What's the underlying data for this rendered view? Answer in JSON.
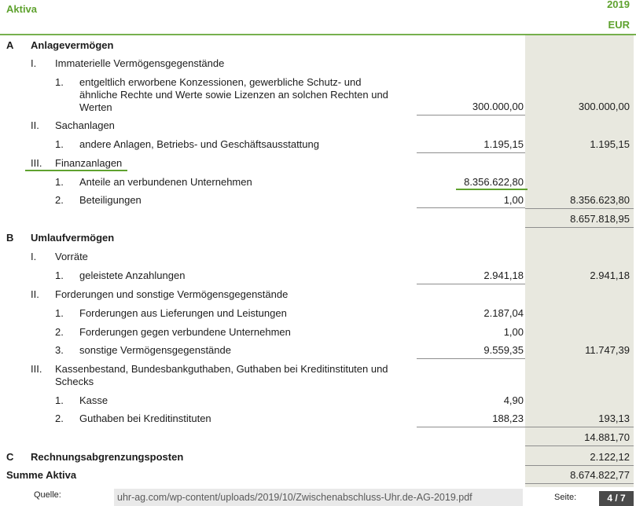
{
  "document": {
    "title": "Aktiva",
    "year": "2019",
    "currency": "EUR"
  },
  "sections": [
    {
      "letter": "A",
      "label": "Anlagevermögen",
      "groups": [
        {
          "numeral": "I.",
          "label": "Immaterielle Vermögensgegenstände",
          "items": [
            {
              "number": "1.",
              "label_lines": [
                "entgeltlich erworbene Konzessionen, gewerbliche Schutz- und",
                "ähnliche Rechte und Werte sowie Lizenzen an solchen Rechten und",
                "Werten"
              ],
              "value": "300.000,00",
              "subtotal": "300.000,00"
            }
          ]
        },
        {
          "numeral": "II.",
          "label": "Sachanlagen",
          "items": [
            {
              "number": "1.",
              "label": "andere Anlagen, Betriebs- und Geschäftsausstattung",
              "value": "1.195,15",
              "subtotal": "1.195,15"
            }
          ]
        },
        {
          "numeral": "III.",
          "label": "Finanzanlagen",
          "items": [
            {
              "number": "1.",
              "label": "Anteile an verbundenen Unternehmen",
              "value": "8.356.622,80"
            },
            {
              "number": "2.",
              "label": "Beteiligungen",
              "value": "1,00",
              "subtotal": "8.356.623,80"
            }
          ]
        }
      ],
      "total": "8.657.818,95"
    },
    {
      "letter": "B",
      "label": "Umlaufvermögen",
      "groups": [
        {
          "numeral": "I.",
          "label": "Vorräte",
          "items": [
            {
              "number": "1.",
              "label": "geleistete Anzahlungen",
              "value": "2.941,18",
              "subtotal": "2.941,18"
            }
          ]
        },
        {
          "numeral": "II.",
          "label": "Forderungen und sonstige Vermögensgegenstände",
          "items": [
            {
              "number": "1.",
              "label": "Forderungen aus Lieferungen und Leistungen",
              "value": "2.187,04"
            },
            {
              "number": "2.",
              "label": "Forderungen gegen verbundene Unternehmen",
              "value": "1,00"
            },
            {
              "number": "3.",
              "label": "sonstige Vermögensgegenstände",
              "value": "9.559,35",
              "subtotal": "11.747,39"
            }
          ]
        },
        {
          "numeral": "III.",
          "label_lines": [
            "Kassenbestand, Bundesbankguthaben, Guthaben bei Kreditinstituten und",
            "Schecks"
          ],
          "items": [
            {
              "number": "1.",
              "label": "Kasse",
              "value": "4,90"
            },
            {
              "number": "2.",
              "label": "Guthaben bei Kreditinstituten",
              "value": "188,23",
              "subtotal": "193,13"
            }
          ]
        }
      ],
      "total": "14.881,70"
    },
    {
      "letter": "C",
      "label": "Rechnungsabgrenzungsposten",
      "total": "2.122,12"
    }
  ],
  "summary": {
    "label": "Summe Aktiva",
    "total": "8.674.822,77"
  },
  "footer": {
    "source_label": "Quelle:",
    "source_url": "uhr-ag.com/wp-content/uploads/2019/10/Zwischenabschluss-Uhr.de-AG-2019.pdf",
    "page_label": "Seite:",
    "page": "4 / 7"
  },
  "colors": {
    "accent_green": "#5fa22f",
    "column_shade": "#e8e8df",
    "page_badge": "#4a4a4a"
  }
}
